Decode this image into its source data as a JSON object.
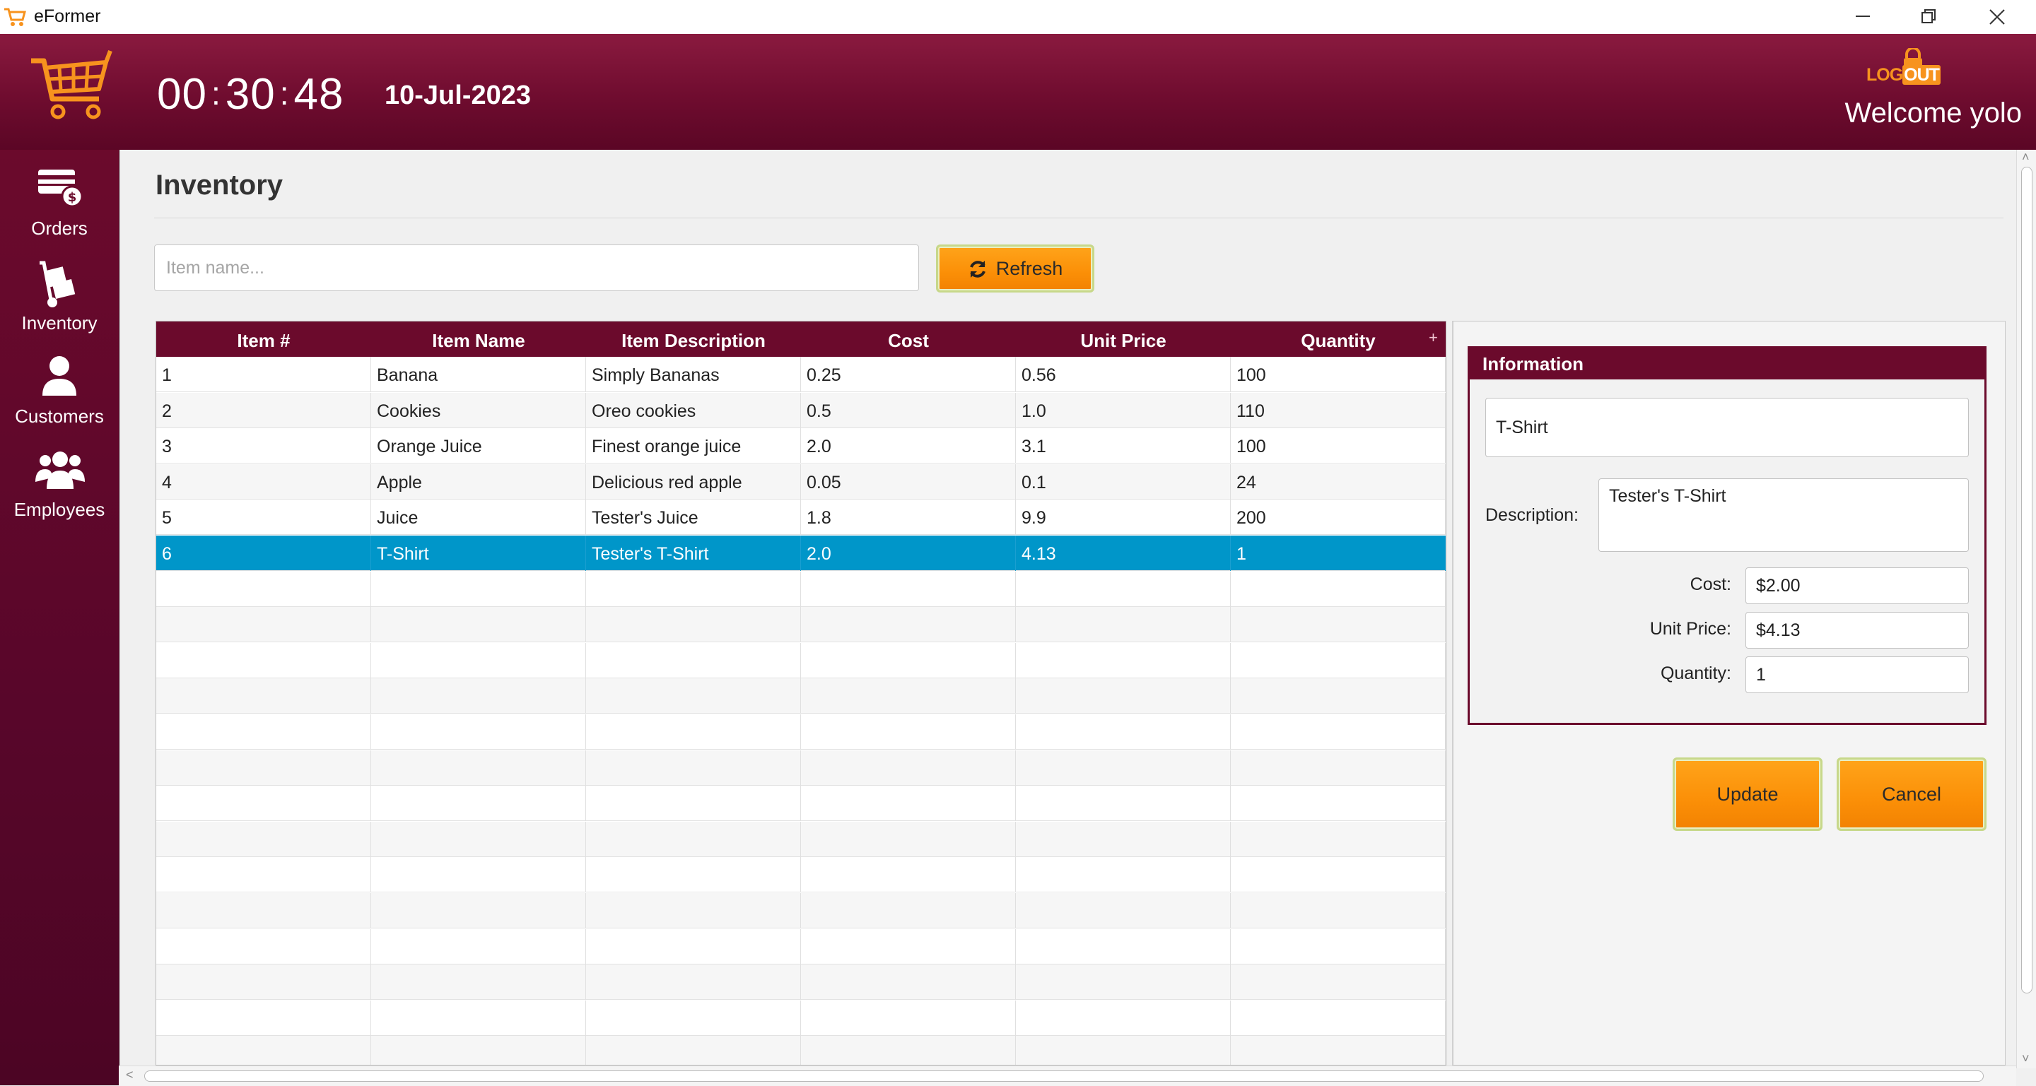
{
  "window": {
    "title": "eFormer"
  },
  "header": {
    "clock": {
      "hours": "00",
      "minutes": "30",
      "seconds": "48"
    },
    "date": "10-Jul-2023",
    "logout_label": {
      "log": "LOG",
      "out": "OUT"
    },
    "welcome": "Welcome yolo"
  },
  "sidebar": {
    "items": [
      {
        "label": "Orders",
        "icon": "credit-card-dollar-icon"
      },
      {
        "label": "Inventory",
        "icon": "hand-truck-icon"
      },
      {
        "label": "Customers",
        "icon": "user-icon"
      },
      {
        "label": "Employees",
        "icon": "users-group-icon"
      }
    ]
  },
  "page": {
    "title": "Inventory"
  },
  "search": {
    "placeholder": "Item name..."
  },
  "toolbar": {
    "refresh_label": "Refresh"
  },
  "table": {
    "columns": [
      "Item #",
      "Item Name",
      "Item Description",
      "Cost",
      "Unit Price",
      "Quantity"
    ],
    "rows": [
      [
        "1",
        "Banana",
        "Simply Bananas",
        "0.25",
        "0.56",
        "100"
      ],
      [
        "2",
        "Cookies",
        "Oreo cookies",
        "0.5",
        "1.0",
        "110"
      ],
      [
        "3",
        "Orange Juice",
        "Finest orange juice",
        "2.0",
        "3.1",
        "100"
      ],
      [
        "4",
        "Apple",
        "Delicious red apple",
        "0.05",
        "0.1",
        "24"
      ],
      [
        "5",
        "Juice",
        "Tester's Juice",
        "1.8",
        "9.9",
        "200"
      ],
      [
        "6",
        "T-Shirt",
        "Tester's T-Shirt",
        "2.0",
        "4.13",
        "1"
      ]
    ],
    "selected_row": 5
  },
  "info": {
    "header": "Information",
    "name_value": "T-Shirt",
    "description_label": "Description:",
    "description_value": "Tester's T-Shirt",
    "cost_label": "Cost:",
    "cost_value": "$2.00",
    "unit_price_label": "Unit Price:",
    "unit_price_value": "$4.13",
    "quantity_label": "Quantity:",
    "quantity_value": "1"
  },
  "actions": {
    "update_label": "Update",
    "cancel_label": "Cancel"
  },
  "colors": {
    "brand": "#6b0a2c",
    "accent": "#fb8f07",
    "selection": "#0096c9"
  }
}
